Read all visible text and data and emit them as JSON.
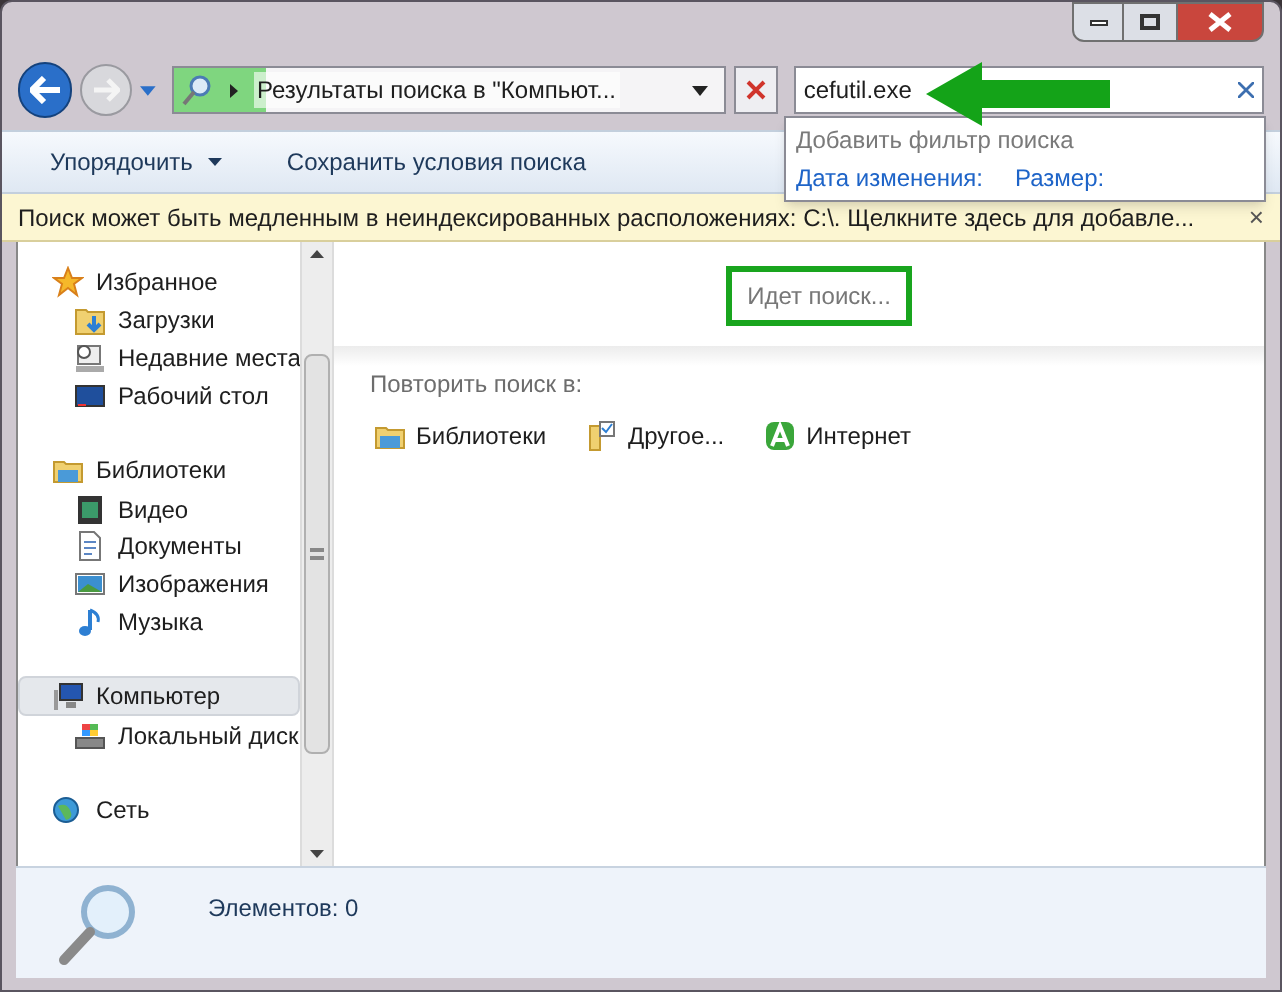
{
  "address_bar": {
    "path": "Результаты поиска в \"Компьют...",
    "progress": {
      "level": 0.17
    }
  },
  "search": {
    "value": "cefutil.exe"
  },
  "search_suggestions": {
    "heading": "Добавить фильтр поиска",
    "filters": [
      "Дата изменения:",
      "Размер:"
    ]
  },
  "toolbar": [
    {
      "label": "Упорядочить",
      "kind": "menu"
    },
    {
      "label": "Сохранить условия поиска",
      "kind": "button"
    }
  ],
  "info_bar": {
    "text": "Поиск может быть медленным в неиндексированных расположениях: C:\\. Щелкните здесь для добавле...",
    "close": "×"
  },
  "sidebar": {
    "groups": [
      {
        "label": "Избранное",
        "selected": false,
        "children": [
          {
            "label": "Загрузки"
          },
          {
            "label": "Недавние места"
          },
          {
            "label": "Рабочий стол"
          }
        ]
      },
      {
        "label": "Библиотеки",
        "selected": false,
        "children": [
          {
            "label": "Видео"
          },
          {
            "label": "Документы"
          },
          {
            "label": "Изображения"
          },
          {
            "label": "Музыка"
          }
        ]
      },
      {
        "label": "Компьютер",
        "selected": true,
        "children": [
          {
            "label": "Локальный диск"
          }
        ]
      },
      {
        "label": "Сеть",
        "selected": false
      }
    ]
  },
  "content": {
    "status": "Идет поиск...",
    "repeat_heading": "Повторить поиск в:",
    "repeat_targets": [
      {
        "label": "Библиотеки"
      },
      {
        "label": "Другое..."
      },
      {
        "label": "Интернет"
      }
    ]
  },
  "status_bar": {
    "count": "Элементов: 0"
  }
}
